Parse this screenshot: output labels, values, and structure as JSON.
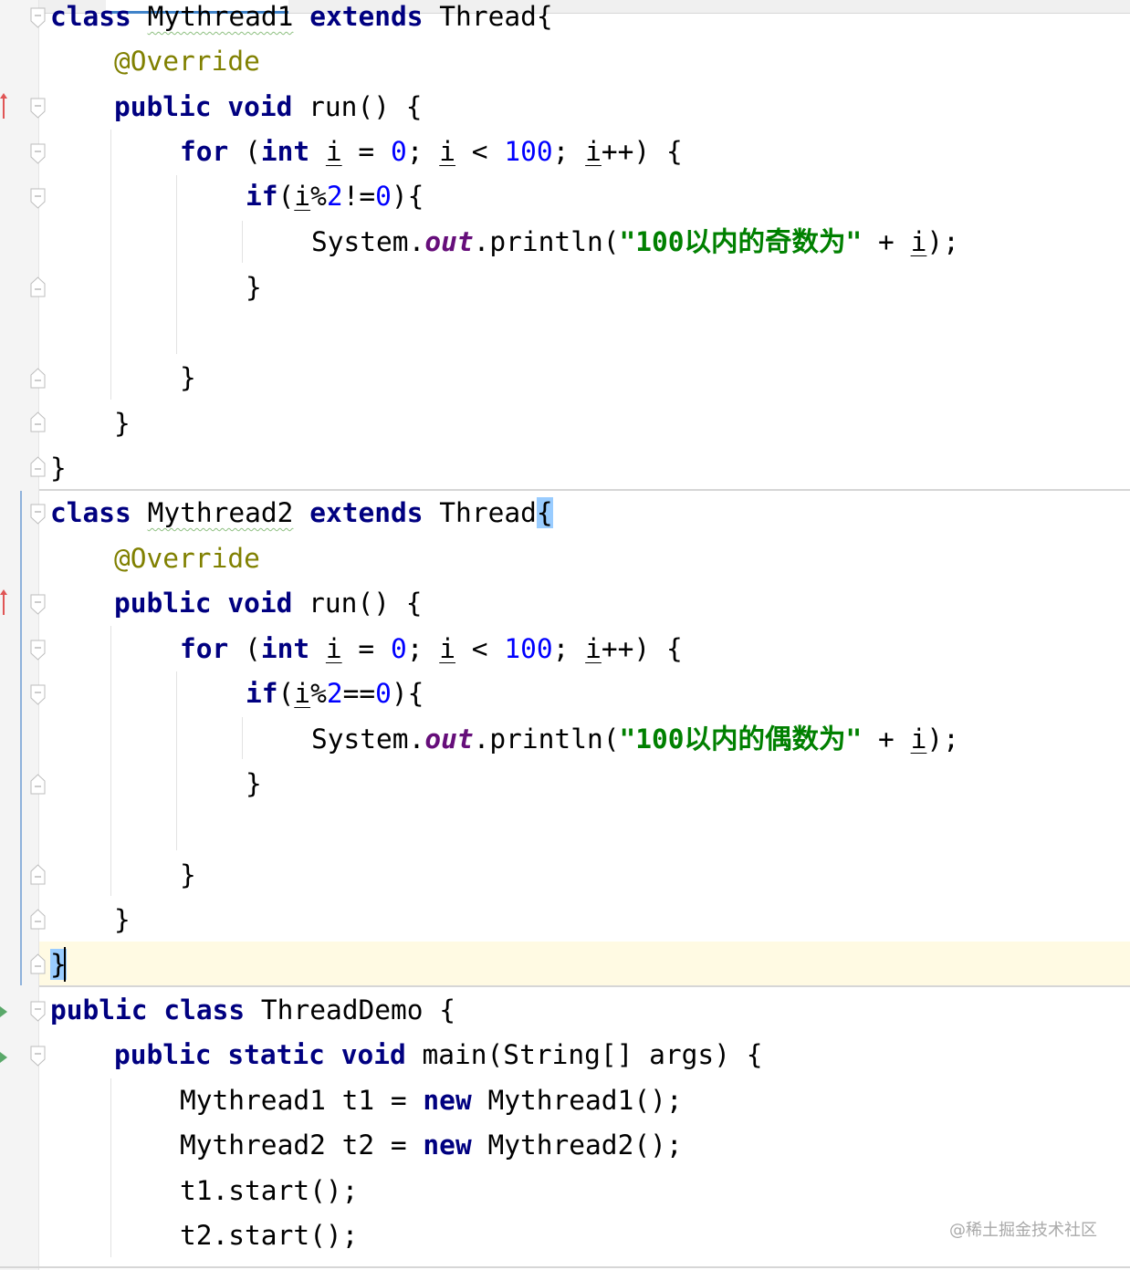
{
  "watermark": "@稀土掘金技术社区",
  "tokens": {
    "class": "class",
    "extends": "extends",
    "public": "public",
    "void": "void",
    "static": "static",
    "for": "for",
    "int": "int",
    "if": "if",
    "new": "new",
    "override": "@Override",
    "out": "out",
    "i": "i",
    "zero": "0",
    "two": "2",
    "hundred": "100"
  },
  "code": {
    "class1_name": "Mythread1",
    "class1_super": "Thread{",
    "run_sig": "run() {",
    "for_open": "for (",
    "for_assign": " = ",
    "for_cmp": " < ",
    "for_inc": "++) {",
    "paren_open": " (",
    "if_open": "(",
    "mod": "%",
    "neq": "!=",
    "eq": "==",
    "if_close": "){",
    "system": "System.",
    "println": ".println(",
    "str_odd": "\"100以内的奇数为\"",
    "str_even": "\"100以内的偶数为\"",
    "concat": " + ",
    "stmt_end": ");",
    "close_brace": "}",
    "class2_name": "Mythread2",
    "class2_super": "Thread",
    "open_brace": "{",
    "demo_name": "ThreadDemo {",
    "main_sig": "main(String[] args) {",
    "t1_decl_type": "Mythread1 t1 = ",
    "t1_ctor": " Mythread1();",
    "t2_decl_type": "Mythread2 t2 = ",
    "t2_ctor": " Mythread2();",
    "t1_start": "t1.start();",
    "t2_start": "t2.start();"
  }
}
